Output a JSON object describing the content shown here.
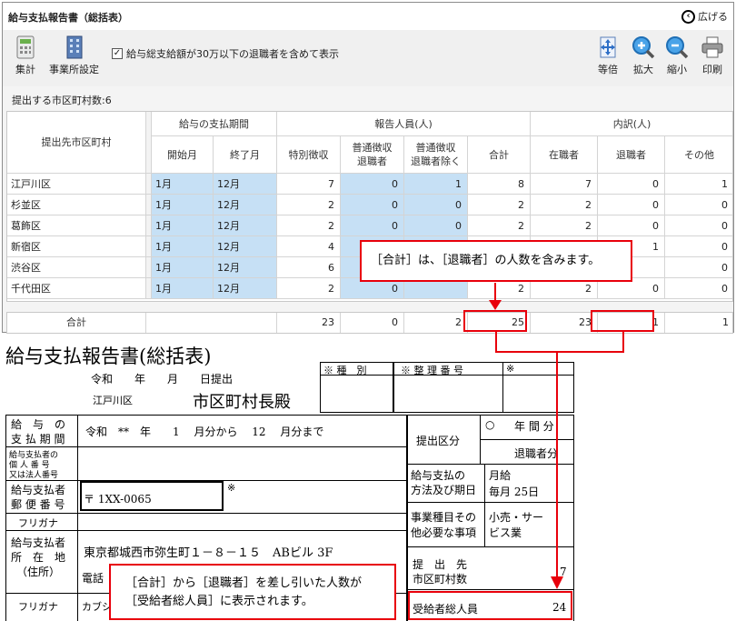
{
  "window": {
    "title": "給与支払報告書（総括表）",
    "expand_label": "広げる"
  },
  "toolbar": {
    "aggregate_label": "集計",
    "office_settings_label": "事業所設定",
    "include_retired_label": "給与総支給額が30万以下の退職者を含めて表示",
    "include_retired_checked": true,
    "actual_size_label": "等倍",
    "zoom_in_label": "拡大",
    "zoom_out_label": "縮小",
    "print_label": "印刷"
  },
  "count_text": "提出する市区町村数:6",
  "table": {
    "headers": {
      "municipality": "提出先市区町村",
      "period_group": "給与の支払期間",
      "start_month": "開始月",
      "end_month": "終了月",
      "reported_group": "報告人員(人)",
      "special": "特別徴収",
      "normal_retired_1": "普通徴収",
      "normal_retired_2": "退職者",
      "normal_excl_1": "普通徴収",
      "normal_excl_2": "退職者除く",
      "total": "合計",
      "breakdown_group": "内訳(人)",
      "employed": "在職者",
      "retired": "退職者",
      "other": "その他"
    },
    "rows": [
      {
        "name": "江戸川区",
        "start": "1月",
        "end": "12月",
        "special": "7",
        "normal_retired": "0",
        "normal_excl": "1",
        "total": "8",
        "employed": "7",
        "retired": "0",
        "other": "1"
      },
      {
        "name": "杉並区",
        "start": "1月",
        "end": "12月",
        "special": "2",
        "normal_retired": "0",
        "normal_excl": "0",
        "total": "2",
        "employed": "2",
        "retired": "0",
        "other": "0"
      },
      {
        "name": "葛飾区",
        "start": "1月",
        "end": "12月",
        "special": "2",
        "normal_retired": "0",
        "normal_excl": "0",
        "total": "2",
        "employed": "2",
        "retired": "0",
        "other": "0"
      },
      {
        "name": "新宿区",
        "start": "1月",
        "end": "12月",
        "special": "4",
        "normal_retired": "",
        "normal_excl": "",
        "total": "",
        "employed": "",
        "retired": "1",
        "other": "0"
      },
      {
        "name": "渋谷区",
        "start": "1月",
        "end": "12月",
        "special": "6",
        "normal_retired": "",
        "normal_excl": "",
        "total": "",
        "employed": "",
        "retired": "",
        "other": "0"
      },
      {
        "name": "千代田区",
        "start": "1月",
        "end": "12月",
        "special": "2",
        "normal_retired": "0",
        "normal_excl": "",
        "total": "2",
        "employed": "2",
        "retired": "0",
        "other": "0"
      }
    ],
    "totals": {
      "label": "合計",
      "special": "23",
      "normal_retired": "0",
      "normal_excl": "2",
      "total": "25",
      "employed": "23",
      "retired": "1",
      "other": "1"
    }
  },
  "callout_top": "［合計］は、［退職者］の人数を含みます。",
  "callout_bottom_line1": "［合計］から［退職者］を差し引いた人数が",
  "callout_bottom_line2": "［受給者総人員］に表示されます。",
  "document": {
    "title": "給与支払報告書(総括表)",
    "date_line": "令和　　年　　月　　日提出",
    "shubetsu": "※ 種　別",
    "seiri": "※ 整 理 番 号",
    "mark": "※",
    "ward": "江戸川区",
    "mayor": "市区町村長殿",
    "pay_period_label_1": "給　与　の",
    "pay_period_label_2": "支 払 期 間",
    "pay_period_value": "令和　**　年　　1　 月分から　 12　 月分まで",
    "submit_category": "提出区分",
    "circle": "○",
    "annual": "年 間 分",
    "retiree_part": "退職者分",
    "personal_no_1": "給与支払者の",
    "personal_no_2": "個 人 番 号",
    "personal_no_3": "又は法人番号",
    "payer_postal_1": "給与支払者",
    "payer_postal_2": "郵 便 番 号",
    "postal_value": "〒 1XX-0065",
    "furigana": "フリガナ",
    "payer_addr_1": "給与支払者",
    "payer_addr_2": "所　在　地",
    "payer_addr_3": "（住所）",
    "address_value": "東京都城西市弥生町１－８－１５　ABビル 3F",
    "phone_label": "電話",
    "furigana_value": "カブシ",
    "pay_method_1": "給与支払の",
    "pay_method_2": "方法及び期日",
    "pay_method_v1": "月給",
    "pay_method_v2": "毎月 25日",
    "business_1": "事業種目その",
    "business_2": "他必要な事項",
    "business_v1": "小売・サー",
    "business_v2": "ビス業",
    "muni_count_1": "提　出　先",
    "muni_count_2": "市区町村数",
    "muni_count_value": "7",
    "recipients_label": "受給者総人員",
    "recipients_value": "24"
  }
}
